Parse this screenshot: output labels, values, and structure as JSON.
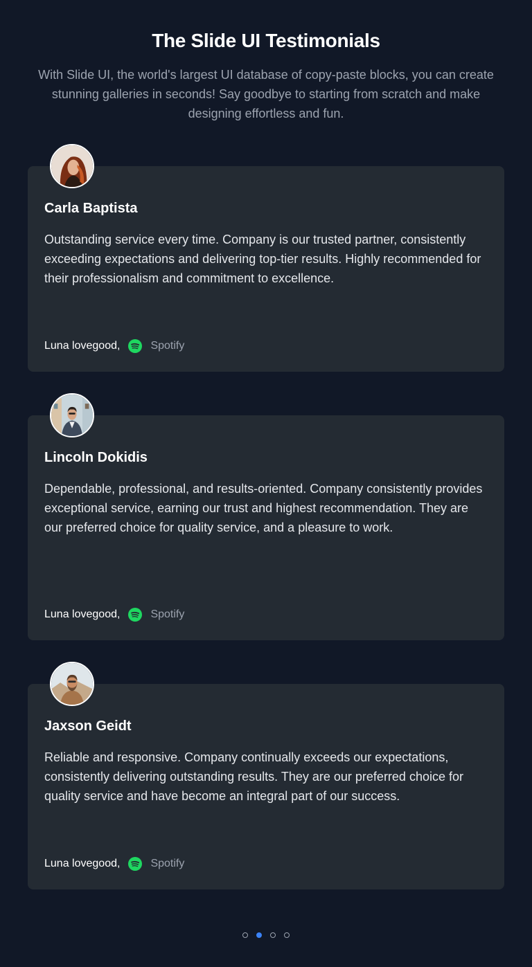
{
  "header": {
    "title": "The Slide UI Testimonials",
    "subtitle": "With Slide UI, the world's largest UI database of copy-paste blocks, you can create stunning galleries in seconds! Say goodbye to starting from scratch and make designing effortless and fun."
  },
  "testimonials": [
    {
      "name": "Carla Baptista",
      "quote": "Outstanding service every time. Company is our trusted partner, consistently exceeding expectations and delivering top-tier results. Highly recommended for their professionalism and commitment to excellence.",
      "author": "Luna lovegood,",
      "company": "Spotify",
      "icon": "spotify-icon"
    },
    {
      "name": "Lincoln Dokidis",
      "quote": "Dependable, professional, and results-oriented. Company consistently provides exceptional service, earning our trust and highest recommendation. They are our preferred choice for quality service, and a pleasure to work.",
      "author": "Luna lovegood,",
      "company": "Spotify",
      "icon": "spotify-icon"
    },
    {
      "name": "Jaxson Geidt",
      "quote": "Reliable and responsive. Company continually exceeds our expectations, consistently delivering outstanding results. They are our preferred choice for quality service and have become an integral part of our success.",
      "author": "Luna lovegood,",
      "company": "Spotify",
      "icon": "spotify-icon"
    }
  ],
  "pagination": {
    "count": 4,
    "active_index": 1
  },
  "colors": {
    "background": "#111827",
    "card": "#242b33",
    "accent": "#3b82f6",
    "spotify": "#1ed760"
  }
}
